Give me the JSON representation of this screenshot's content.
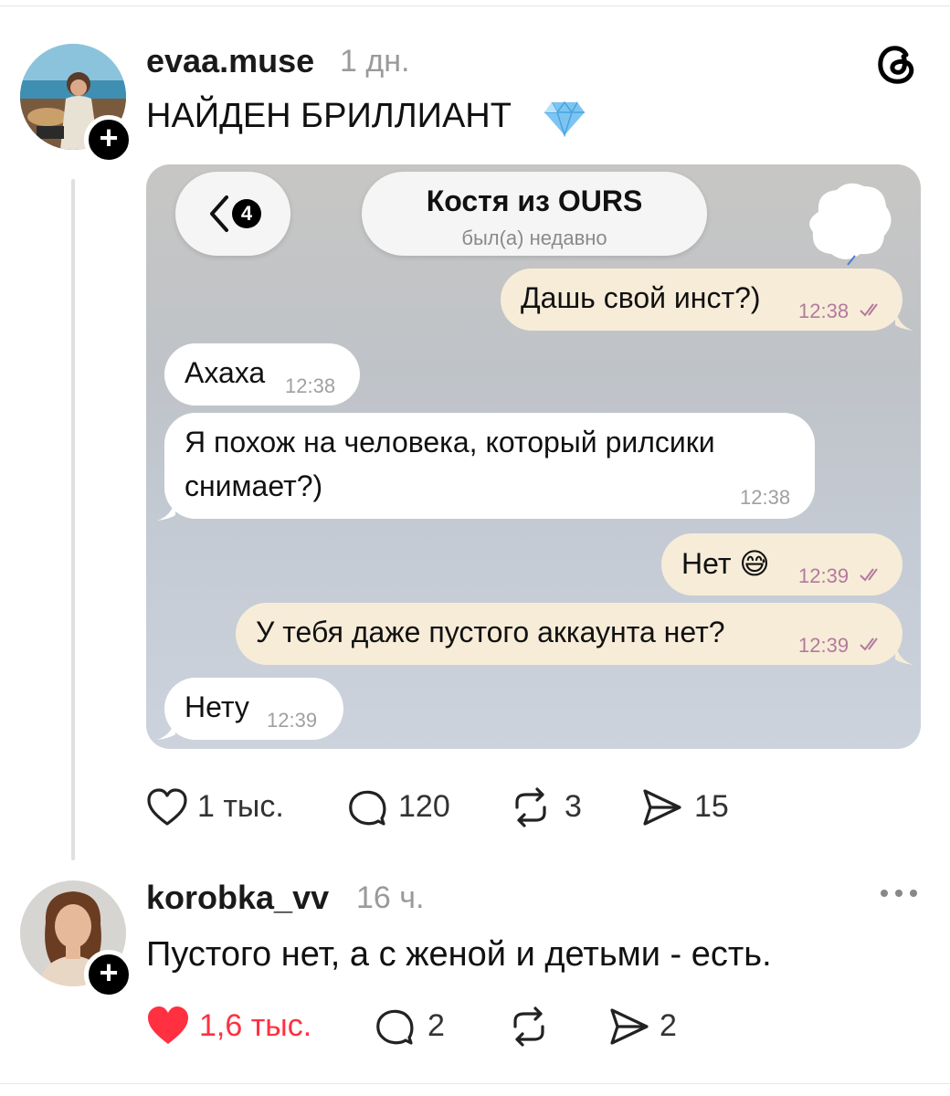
{
  "post": {
    "username": "evaa.muse",
    "time_ago": "1 дн.",
    "text": "НАЙДЕН БРИЛЛИАНТ",
    "emoji": "💎",
    "chat_screenshot": {
      "back_count": "4",
      "contact_name": "Костя из OURS",
      "status": "был(а) недавно",
      "messages": [
        {
          "dir": "out",
          "text": "Дашь свой инст?)",
          "time": "12:38"
        },
        {
          "dir": "in",
          "text": "Ахаха",
          "time": "12:38"
        },
        {
          "dir": "in",
          "text_line1": "Я похож на человека, который рилсики",
          "text_line2": "снимает?)",
          "time": "12:38"
        },
        {
          "dir": "out",
          "text": "Нет 😅",
          "time": "12:39"
        },
        {
          "dir": "out",
          "text": "У тебя даже пустого аккаунта нет?",
          "time": "12:39"
        },
        {
          "dir": "in",
          "text": "Нету",
          "time": "12:39"
        }
      ]
    },
    "actions": {
      "likes": "1 тыс.",
      "replies": "120",
      "reposts": "3",
      "shares": "15"
    }
  },
  "reply": {
    "username": "korobka_vv",
    "time_ago": "16 ч.",
    "text": "Пустого нет, а с женой и детьми - есть.",
    "actions": {
      "likes": "1,6 тыс.",
      "replies": "2",
      "reposts": "",
      "shares": "2"
    },
    "liked": true
  },
  "colors": {
    "like_active": "#ff3040",
    "outgoing_bubble": "#f7ecd8",
    "incoming_bubble": "#ffffff",
    "muted_text": "#9a9a9a"
  },
  "icons": {
    "app_logo": "threads-logo-icon",
    "like": "heart-icon",
    "reply": "comment-icon",
    "repost": "repost-icon",
    "share": "send-icon",
    "more": "more-dots-icon"
  }
}
